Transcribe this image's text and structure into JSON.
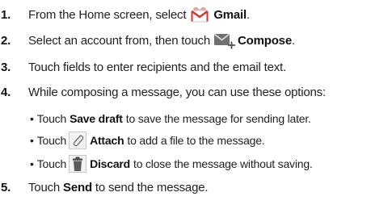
{
  "steps": [
    {
      "num": "1.",
      "pre": "From the Home screen, select",
      "bold": "Gmail",
      "post": "."
    },
    {
      "num": "2.",
      "pre": "Select an account from, then touch",
      "bold": "Compose",
      "post": "."
    },
    {
      "num": "3.",
      "text": "Touch fields to enter recipients and the email text."
    },
    {
      "num": "4.",
      "text": "While composing a message, you can use these options:"
    },
    {
      "num": "5.",
      "pre": "Touch",
      "bold": "Send",
      "post": "to send the message."
    }
  ],
  "bullets": [
    {
      "marker": "•",
      "pre": "Touch",
      "bold": "Save draft",
      "post": "to save the message for sending later."
    },
    {
      "marker": "•",
      "pre": "Touch",
      "bold": "Attach",
      "post": "to add a file to the message."
    },
    {
      "marker": "•",
      "pre": "Touch",
      "bold": "Discard",
      "post": "to close the message without saving."
    }
  ],
  "icons": {
    "gmail": "gmail-icon",
    "compose": "compose-icon",
    "attach": "attach-icon",
    "discard": "discard-icon"
  },
  "colors": {
    "gmail_red": "#d9342b",
    "icon_gray": "#8a8a8a",
    "text": "#222222"
  }
}
